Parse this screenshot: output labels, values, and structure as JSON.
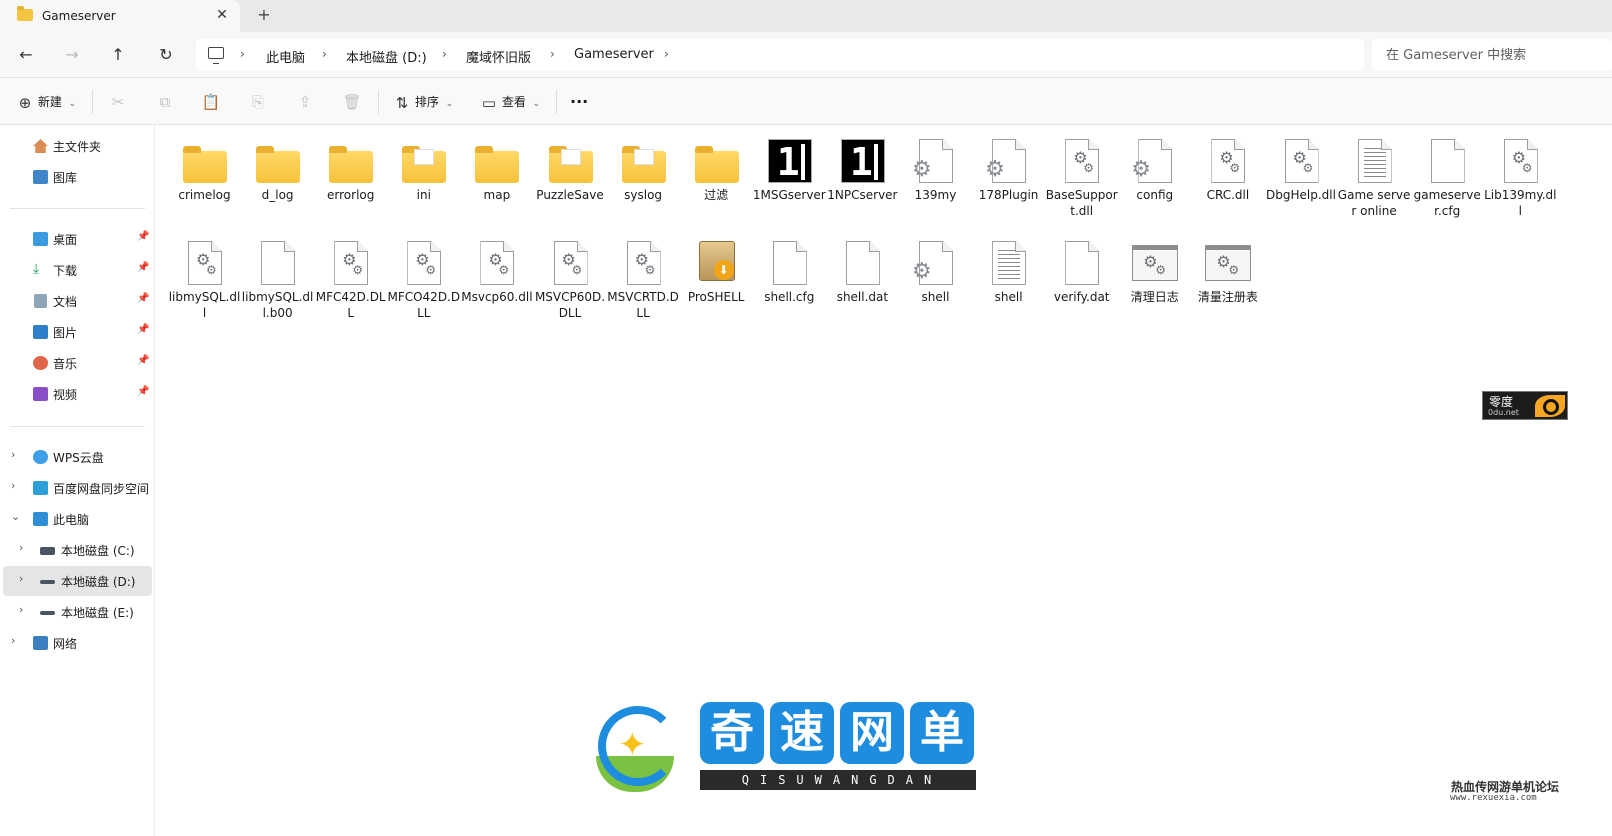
{
  "tab": {
    "title": "Gameserver",
    "close": "✕",
    "add": "+"
  },
  "nav": {
    "back": "←",
    "forward": "→",
    "up": "↑",
    "refresh": "↻"
  },
  "breadcrumb": [
    {
      "label": "此电脑"
    },
    {
      "label": "本地磁盘 (D:)"
    },
    {
      "label": "魔域怀旧版"
    },
    {
      "label": "Gameserver"
    }
  ],
  "search": {
    "placeholder": "在 Gameserver 中搜索"
  },
  "toolbar": {
    "new_label": "新建",
    "sort_label": "排序",
    "view_label": "查看",
    "more": "···"
  },
  "sidebar": {
    "top": [
      {
        "label": "主文件夹",
        "icon": "home-icon"
      },
      {
        "label": "图库",
        "icon": "gallery-icon"
      }
    ],
    "pinned": [
      {
        "label": "桌面",
        "icon": "desktop-icon"
      },
      {
        "label": "下载",
        "icon": "download-icon"
      },
      {
        "label": "文档",
        "icon": "documents-icon"
      },
      {
        "label": "图片",
        "icon": "pictures-icon"
      },
      {
        "label": "音乐",
        "icon": "music-icon"
      },
      {
        "label": "视频",
        "icon": "videos-icon"
      }
    ],
    "tree": [
      {
        "label": "WPS云盘",
        "icon": "cloud-icon"
      },
      {
        "label": "百度网盘同步空间",
        "icon": "baidu-icon"
      },
      {
        "label": "此电脑",
        "icon": "this-pc-icon"
      },
      {
        "label": "本地磁盘 (C:)",
        "icon": "drive-c-icon"
      },
      {
        "label": "本地磁盘 (D:)",
        "icon": "drive-icon"
      },
      {
        "label": "本地磁盘 (E:)",
        "icon": "drive-icon"
      },
      {
        "label": "网络",
        "icon": "network-icon"
      }
    ]
  },
  "files_row1": [
    {
      "name": "crimelog",
      "type": "folder"
    },
    {
      "name": "d_log",
      "type": "folder"
    },
    {
      "name": "errorlog",
      "type": "folder"
    },
    {
      "name": "ini",
      "type": "folder-doc"
    },
    {
      "name": "map",
      "type": "folder"
    },
    {
      "name": "PuzzleSave",
      "type": "folder-doc"
    },
    {
      "name": "syslog",
      "type": "folder-doc"
    },
    {
      "name": "过滤",
      "type": "folder"
    },
    {
      "name": "1MSGserver",
      "type": "exe-one"
    },
    {
      "name": "1NPCserver",
      "type": "exe-one"
    },
    {
      "name": "139my",
      "type": "doc-gear"
    },
    {
      "name": "178Plugin",
      "type": "doc-gear"
    },
    {
      "name": "BaseSupport.dll",
      "type": "dll"
    },
    {
      "name": "config",
      "type": "doc-gear"
    },
    {
      "name": "CRC.dll",
      "type": "dll"
    },
    {
      "name": "DbgHelp.dll",
      "type": "dll"
    },
    {
      "name": "Game server online",
      "type": "text"
    },
    {
      "name": "gameserver.cfg",
      "type": "doc"
    },
    {
      "name": "Lib139my.dll",
      "type": "dll"
    }
  ],
  "files_row2": [
    {
      "name": "libmySQL.dll",
      "type": "dll"
    },
    {
      "name": "libmySQL.dll.b00",
      "type": "doc"
    },
    {
      "name": "MFC42D.DLL",
      "type": "dll"
    },
    {
      "name": "MFCO42D.DLL",
      "type": "dll"
    },
    {
      "name": "Msvcp60.dll",
      "type": "dll"
    },
    {
      "name": "MSVCP60D.DLL",
      "type": "dll"
    },
    {
      "name": "MSVCRTD.DLL",
      "type": "dll"
    },
    {
      "name": "ProSHELL",
      "type": "box"
    },
    {
      "name": "shell.cfg",
      "type": "doc"
    },
    {
      "name": "shell.dat",
      "type": "doc"
    },
    {
      "name": "shell",
      "type": "doc-gear"
    },
    {
      "name": "shell",
      "type": "text"
    },
    {
      "name": "verify.dat",
      "type": "doc"
    },
    {
      "name": "清理日志",
      "type": "win-exe"
    },
    {
      "name": "清量注册表",
      "type": "win-exe"
    }
  ],
  "watermarks": {
    "zero": {
      "line1": "零度",
      "line2": "0du.net"
    },
    "qisu": {
      "chars": [
        "奇",
        "速",
        "网",
        "单"
      ],
      "sub": "QISUWANGDAN"
    },
    "corner": {
      "line1": "热血传网游单机论坛",
      "line2": "www.rexuexia.com"
    }
  },
  "colors": {
    "folder": "#f6c23b",
    "accent": "#1e8de0",
    "selected": "#e5e5e5"
  }
}
